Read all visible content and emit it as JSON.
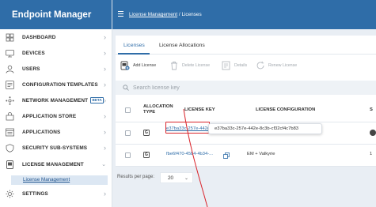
{
  "app": {
    "title": "Endpoint Manager"
  },
  "sidebar": {
    "items": [
      {
        "label": "DASHBOARD",
        "icon": "dashboard-icon"
      },
      {
        "label": "DEVICES",
        "icon": "devices-icon"
      },
      {
        "label": "USERS",
        "icon": "users-icon"
      },
      {
        "label": "CONFIGURATION TEMPLATES",
        "icon": "templates-icon"
      },
      {
        "label": "NETWORK MANAGEMENT",
        "icon": "network-icon",
        "badge": "BETA"
      },
      {
        "label": "APPLICATION STORE",
        "icon": "store-icon"
      },
      {
        "label": "APPLICATIONS",
        "icon": "applications-icon"
      },
      {
        "label": "SECURITY SUB-SYSTEMS",
        "icon": "shield-icon"
      },
      {
        "label": "LICENSE MANAGEMENT",
        "icon": "license-icon",
        "expanded": true
      },
      {
        "label": "SETTINGS",
        "icon": "gear-icon"
      }
    ],
    "sub_item": "License Management"
  },
  "breadcrumb": {
    "parent": "License Management",
    "separator": "/",
    "current": "Licenses"
  },
  "tabs": [
    {
      "label": "Licenses",
      "active": true
    },
    {
      "label": "License Allocations",
      "active": false
    }
  ],
  "toolbar": {
    "add": "Add License",
    "delete": "Delete License",
    "details": "Details",
    "renew": "Renew License"
  },
  "search": {
    "placeholder": "Search license key"
  },
  "table": {
    "columns": [
      "ALLOCATION TYPE",
      "LICENSE KEY",
      "LICENSE CONFIGURATION",
      "S"
    ],
    "rows": [
      {
        "type": "G",
        "key": "e37ba33c-257e-442e...",
        "config": "",
        "extra": ""
      },
      {
        "type": "G",
        "key": "fbe6f470-45b4-4b34-...",
        "config": "EM + Valkyrie",
        "extra": "1"
      }
    ]
  },
  "tooltip": {
    "text": "e37ba33c-257e-442e-8c3b-cf32cf4c7b83"
  },
  "pagination": {
    "label": "Results per page:",
    "value": "20"
  },
  "colors": {
    "brand": "#2f6da8",
    "highlight": "#d9232a"
  }
}
